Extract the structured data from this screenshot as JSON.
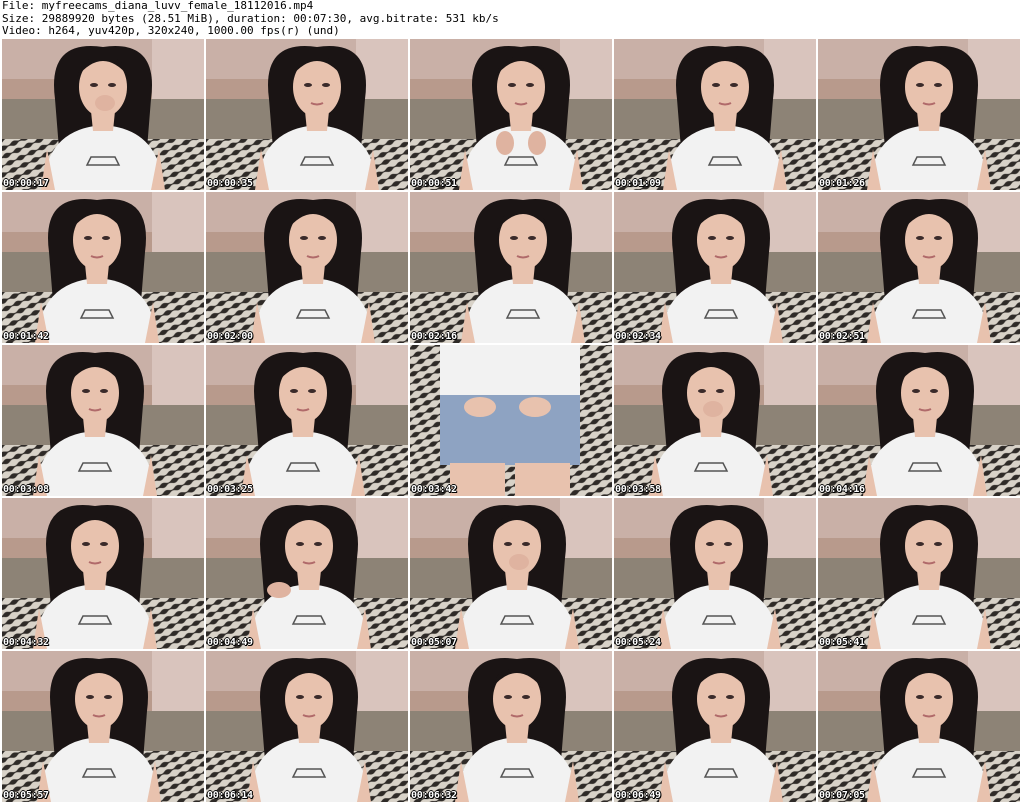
{
  "header": {
    "file_line": "File: myfreecams_diana_luvv_female_18112016.mp4",
    "size_line": "Size: 29889920 bytes (28.51 MiB), duration: 00:07:30, avg.bitrate: 531 kb/s",
    "video_line": "Video: h264, yuv420p, 320x240, 1000.00 fps(r) (und)"
  },
  "thumbnails": [
    {
      "timestamp": "00:00:17"
    },
    {
      "timestamp": "00:00:35"
    },
    {
      "timestamp": "00:00:51"
    },
    {
      "timestamp": "00:01:09"
    },
    {
      "timestamp": "00:01:26"
    },
    {
      "timestamp": "00:01:42"
    },
    {
      "timestamp": "00:02:00"
    },
    {
      "timestamp": "00:02:16"
    },
    {
      "timestamp": "00:02:34"
    },
    {
      "timestamp": "00:02:51"
    },
    {
      "timestamp": "00:03:08"
    },
    {
      "timestamp": "00:03:25"
    },
    {
      "timestamp": "00:03:42"
    },
    {
      "timestamp": "00:03:58"
    },
    {
      "timestamp": "00:04:16"
    },
    {
      "timestamp": "00:04:32"
    },
    {
      "timestamp": "00:04:49"
    },
    {
      "timestamp": "00:05:07"
    },
    {
      "timestamp": "00:05:24"
    },
    {
      "timestamp": "00:05:41"
    },
    {
      "timestamp": "00:05:57"
    },
    {
      "timestamp": "00:06:14"
    },
    {
      "timestamp": "00:06:32"
    },
    {
      "timestamp": "00:06:49"
    },
    {
      "timestamp": "00:07:05"
    }
  ],
  "colors": {
    "wall": "#b89a8c",
    "couch": "#8d8376",
    "zebra_dark": "#2e2a27",
    "zebra_light": "#d8d2c8",
    "hair": "#1a1414",
    "skin": "#e8c2ae",
    "shirt": "#f2f2f2",
    "denim": "#8ea3c2"
  }
}
